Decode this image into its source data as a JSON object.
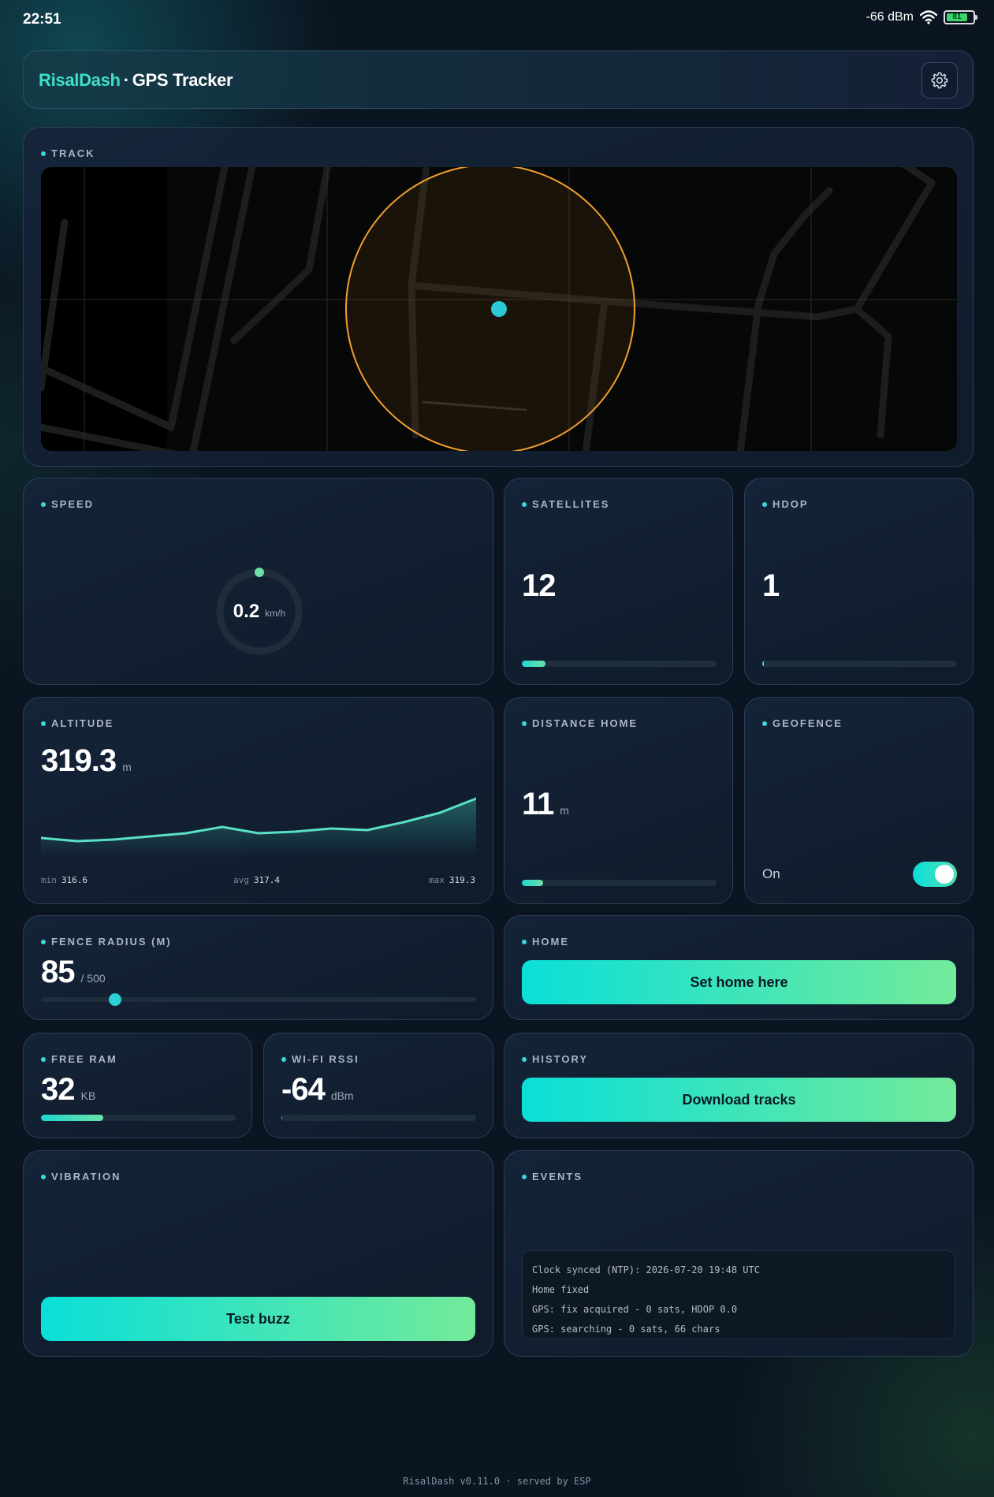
{
  "statusbar": {
    "time": "22:51",
    "signal": "-66 dBm",
    "battery": "81"
  },
  "header": {
    "brand": "RisalDash",
    "separator": "·",
    "title": "GPS Tracker"
  },
  "colors": {
    "accent": "#3cd8d8",
    "accent2": "#6de0a8",
    "fence": "#f0a02c",
    "position": "#2bc9d6"
  },
  "track": {
    "title": "TRACK"
  },
  "speed": {
    "title": "SPEED",
    "value": "0.2",
    "unit": "km/h",
    "level": 0.01
  },
  "satellites": {
    "title": "SATELLITES",
    "value": "12",
    "level": 0.12
  },
  "hdop": {
    "title": "HDOP",
    "value": "1",
    "level": 0.01
  },
  "altitude": {
    "title": "ALTITUDE",
    "value": "319.3",
    "unit": "m",
    "min_label": "min",
    "min": "316.6",
    "avg_label": "avg",
    "avg": "317.4",
    "max_label": "max",
    "max": "319.3"
  },
  "chart_data": {
    "type": "area",
    "x": [
      1,
      2,
      3,
      4,
      5,
      6,
      7,
      8,
      9,
      10,
      11,
      12,
      13
    ],
    "values": [
      316.8,
      316.6,
      316.7,
      316.9,
      317.1,
      317.5,
      317.1,
      317.2,
      317.4,
      317.3,
      317.8,
      318.4,
      319.3
    ],
    "ylim": [
      316.6,
      319.3
    ]
  },
  "distance_home": {
    "title": "DISTANCE HOME",
    "value": "11",
    "unit": "m",
    "level": 0.11
  },
  "geofence": {
    "title": "GEOFENCE",
    "label": "On",
    "enabled": true
  },
  "fence_radius": {
    "title": "FENCE RADIUS (M)",
    "value": "85",
    "max": "/ 500",
    "level": 0.17
  },
  "home": {
    "title": "HOME",
    "button": "Set home here"
  },
  "free_ram": {
    "title": "FREE RAM",
    "value": "32",
    "unit": "KB",
    "level": 0.32
  },
  "wifi_rssi": {
    "title": "WI-FI RSSI",
    "value": "-64",
    "unit": "dBm",
    "level": 0.0
  },
  "history": {
    "title": "HISTORY",
    "button": "Download tracks"
  },
  "vibration": {
    "title": "VIBRATION",
    "button": "Test buzz"
  },
  "events": {
    "title": "EVENTS",
    "lines": [
      "Clock synced (NTP): 2026-07-20 19:48 UTC",
      "Home fixed",
      "GPS: fix acquired - 0 sats, HDOP 0.0",
      "GPS: searching - 0 sats, 66 chars"
    ]
  },
  "footer": {
    "text": "RisalDash v0.11.0 · served by ESP"
  }
}
